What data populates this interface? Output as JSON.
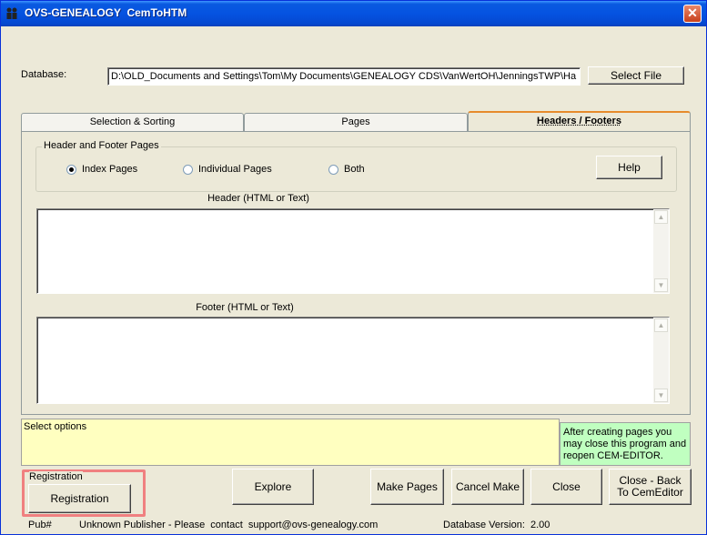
{
  "window": {
    "title": "OVS-GENEALOGY  CemToHTM",
    "close_glyph": "✕"
  },
  "database": {
    "label": "Database:",
    "path": "D:\\OLD_Documents and Settings\\Tom\\My Documents\\GENEALOGY CDS\\VanWertOH\\JenningsTWP\\Ha",
    "select_label": "Select File"
  },
  "tabs": [
    {
      "label": "Selection & Sorting"
    },
    {
      "label": "Pages"
    },
    {
      "label": "Headers / Footers",
      "active": true
    }
  ],
  "header_footer_group": {
    "title": "Header and Footer Pages",
    "options": [
      {
        "label": "Index Pages",
        "checked": true
      },
      {
        "label": "Individual Pages",
        "checked": false
      },
      {
        "label": "Both",
        "checked": false
      }
    ],
    "help_label": "Help"
  },
  "header": {
    "label": "Header (HTML or Text)",
    "value": ""
  },
  "footer": {
    "label": "Footer (HTML or Text)",
    "value": ""
  },
  "status": {
    "text": "Select options",
    "note": "After creating pages you may close this program and reopen CEM-EDITOR."
  },
  "registration": {
    "group_title": "Registration",
    "button_label": "Registration"
  },
  "actions": {
    "explore": "Explore",
    "make_pages": "Make Pages",
    "cancel_make": "Cancel Make",
    "close": "Close",
    "close_back": "Close - Back To CemEditor"
  },
  "footer_bar": {
    "pub_label": "Pub#",
    "publisher": "Unknown Publisher - Please  contact  support@ovs-genealogy.com",
    "db_version_label": "Database Version:",
    "db_version": "2.00"
  },
  "colors": {
    "status_bg": "#ffffc0",
    "note_bg": "#c0ffc0",
    "registration_highlight": "#f08080",
    "title_bar": "#0553e1"
  }
}
